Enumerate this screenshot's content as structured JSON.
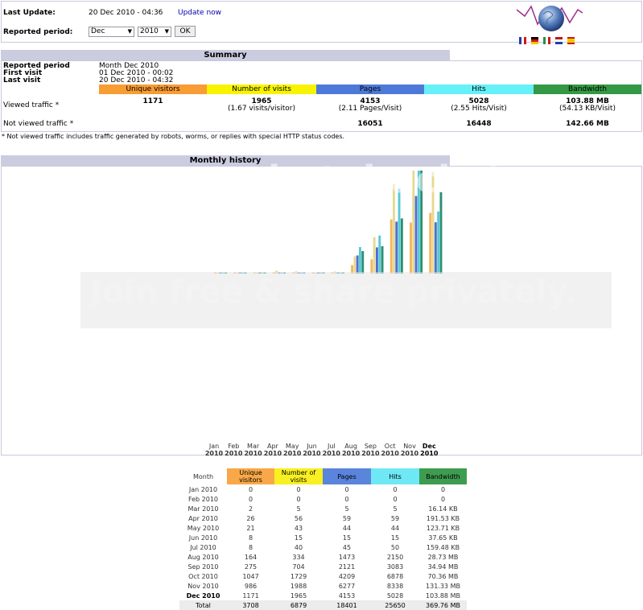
{
  "header": {
    "last_update_label": "Last Update:",
    "last_update_value": "20 Dec 2010 - 04:36",
    "update_now": "Update now",
    "reported_period_label": "Reported period:",
    "month_select": "Dec",
    "year_select": "2010",
    "ok_button": "OK"
  },
  "summary": {
    "title": "Summary",
    "reported_period_label": "Reported period",
    "reported_period_value": "Month Dec 2010",
    "first_visit_label": "First visit",
    "first_visit_value": "01 Dec 2010 - 00:02",
    "last_visit_label": "Last visit",
    "last_visit_value": "20 Dec 2010 - 04:32",
    "columns": [
      "Unique visitors",
      "Number of visits",
      "Pages",
      "Hits",
      "Bandwidth"
    ],
    "column_colors": [
      "#f89c34",
      "#f8f400",
      "#4d7ad8",
      "#66f0f8",
      "#339944"
    ],
    "viewed_label": "Viewed traffic *",
    "viewed": {
      "unique": "1171",
      "visits": "1965",
      "visits_sub": "(1.67 visits/visitor)",
      "pages": "4153",
      "pages_sub": "(2.11 Pages/Visit)",
      "hits": "5028",
      "hits_sub": "(2.55 Hits/Visit)",
      "bandwidth": "103.88 MB",
      "bandwidth_sub": "(54.13 KB/Visit)"
    },
    "not_viewed_label": "Not viewed traffic *",
    "not_viewed": {
      "pages": "16051",
      "hits": "16448",
      "bandwidth": "142.66 MB"
    },
    "note": "* Not viewed traffic includes traffic generated by robots, worms, or replies with special HTTP status codes."
  },
  "monthly": {
    "title": "Monthly history",
    "month_labels": [
      [
        "Jan",
        "2010"
      ],
      [
        "Feb",
        "2010"
      ],
      [
        "Mar",
        "2010"
      ],
      [
        "Apr",
        "2010"
      ],
      [
        "May",
        "2010"
      ],
      [
        "Jun",
        "2010"
      ],
      [
        "Jul",
        "2010"
      ],
      [
        "Aug",
        "2010"
      ],
      [
        "Sep",
        "2010"
      ],
      [
        "Oct",
        "2010"
      ],
      [
        "Nov",
        "2010"
      ],
      [
        "Dec",
        "2010"
      ]
    ],
    "table_headers": [
      "Month",
      "Unique visitors",
      "Number of visits",
      "Pages",
      "Hits",
      "Bandwidth"
    ],
    "rows": [
      [
        "Jan 2010",
        "0",
        "0",
        "0",
        "0",
        "0"
      ],
      [
        "Feb 2010",
        "0",
        "0",
        "0",
        "0",
        "0"
      ],
      [
        "Mar 2010",
        "2",
        "5",
        "5",
        "5",
        "16.14 KB"
      ],
      [
        "Apr 2010",
        "26",
        "56",
        "59",
        "59",
        "191.53 KB"
      ],
      [
        "May 2010",
        "21",
        "43",
        "44",
        "44",
        "123.71 KB"
      ],
      [
        "Jun 2010",
        "8",
        "15",
        "15",
        "15",
        "37.65 KB"
      ],
      [
        "Jul 2010",
        "8",
        "40",
        "45",
        "50",
        "159.48 KB"
      ],
      [
        "Aug 2010",
        "164",
        "334",
        "1473",
        "2150",
        "28.73 MB"
      ],
      [
        "Sep 2010",
        "275",
        "704",
        "2121",
        "3083",
        "34.94 MB"
      ],
      [
        "Oct 2010",
        "1047",
        "1729",
        "4209",
        "6878",
        "70.36 MB"
      ],
      [
        "Nov 2010",
        "986",
        "1988",
        "6277",
        "8338",
        "131.33 MB"
      ],
      [
        "Dec 2010",
        "1171",
        "1965",
        "4153",
        "5028",
        "103.88 MB"
      ]
    ],
    "total": [
      "Total",
      "3708",
      "6879",
      "18401",
      "25650",
      "369.76 MB"
    ]
  },
  "chart_data": {
    "type": "bar",
    "categories": [
      "Jan 2010",
      "Feb 2010",
      "Mar 2010",
      "Apr 2010",
      "May 2010",
      "Jun 2010",
      "Jul 2010",
      "Aug 2010",
      "Sep 2010",
      "Oct 2010",
      "Nov 2010",
      "Dec 2010"
    ],
    "series": [
      {
        "name": "Unique visitors",
        "color": "#f0b860",
        "values": [
          0,
          0,
          2,
          26,
          21,
          8,
          8,
          164,
          275,
          1047,
          986,
          1171
        ]
      },
      {
        "name": "Number of visits",
        "color": "#e8d890",
        "values": [
          0,
          0,
          5,
          56,
          43,
          15,
          40,
          334,
          704,
          1729,
          1988,
          1965
        ]
      },
      {
        "name": "Pages",
        "color": "#4d6fd0",
        "values": [
          0,
          0,
          5,
          59,
          44,
          15,
          45,
          1473,
          2121,
          4209,
          6277,
          4153
        ]
      },
      {
        "name": "Hits",
        "color": "#58c8d8",
        "values": [
          0,
          0,
          5,
          59,
          44,
          15,
          50,
          2150,
          3083,
          6878,
          8338,
          5028
        ]
      },
      {
        "name": "Bandwidth",
        "color": "#2a9070",
        "unit": "MB",
        "values": [
          0.016,
          0,
          0.016,
          0.19,
          0.12,
          0.037,
          0.16,
          28.73,
          34.94,
          70.36,
          131.33,
          103.88
        ]
      }
    ]
  },
  "watermark": {
    "line1": "photobucket",
    "line2": "Join free & share privately."
  }
}
